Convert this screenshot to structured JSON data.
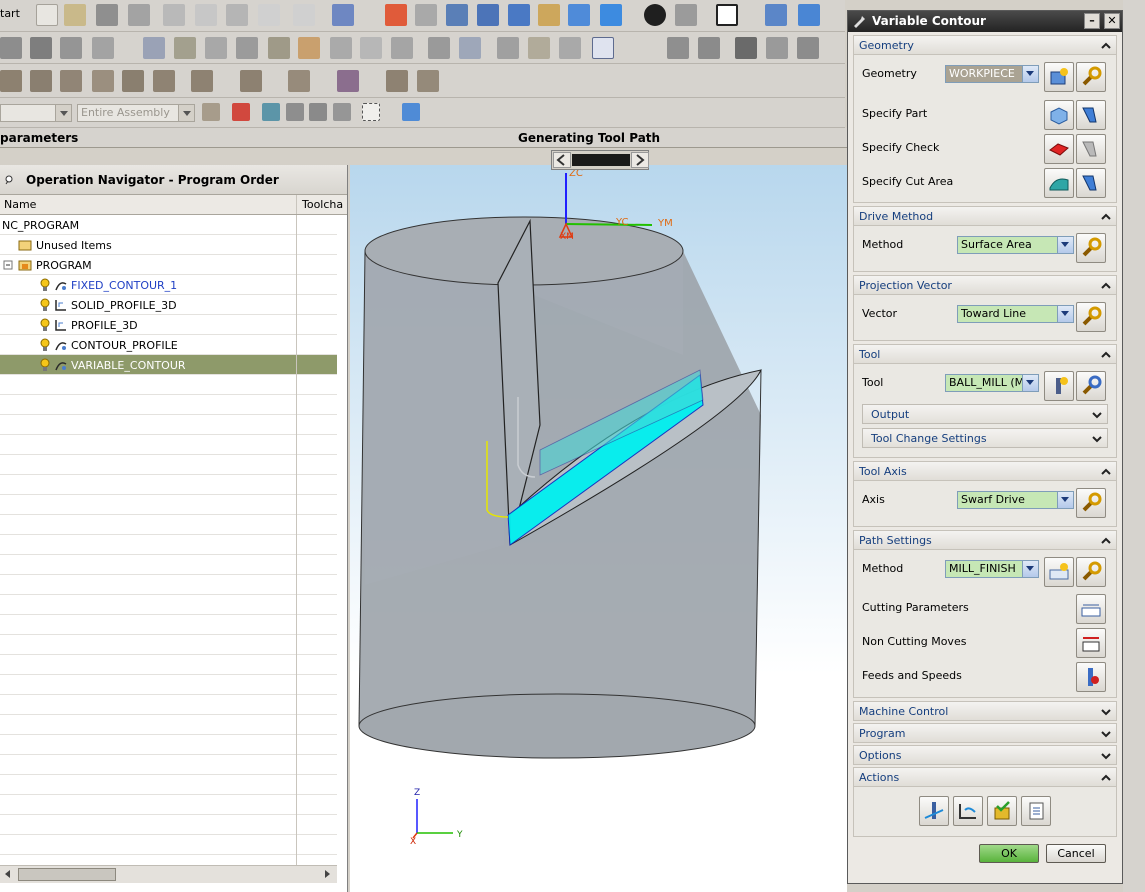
{
  "toolbar": {
    "start_label": "tart",
    "assembly_combo": "Entire Assembly"
  },
  "status": {
    "left": "parameters",
    "center": "Generating Tool Path"
  },
  "navigator": {
    "title": "Operation Navigator - Program Order",
    "columns": [
      "Name",
      "Toolcha"
    ],
    "rows": [
      {
        "label": "NC_PROGRAM",
        "indent": 0,
        "icon": "none"
      },
      {
        "label": "Unused Items",
        "indent": 1,
        "icon": "folder-icon"
      },
      {
        "label": "PROGRAM",
        "indent": 1,
        "icon": "program-folder-icon"
      },
      {
        "label": "FIXED_CONTOUR_1",
        "indent": 2,
        "icon": "contour-op-icon",
        "link": true
      },
      {
        "label": "SOLID_PROFILE_3D",
        "indent": 2,
        "icon": "profile-op-icon"
      },
      {
        "label": "PROFILE_3D",
        "indent": 2,
        "icon": "profile-op-icon"
      },
      {
        "label": "CONTOUR_PROFILE",
        "indent": 2,
        "icon": "contour-op-icon"
      },
      {
        "label": "VARIABLE_CONTOUR",
        "indent": 2,
        "icon": "contour-op-icon",
        "selected": true
      }
    ]
  },
  "viewport": {
    "wcs_labels": {
      "zc": "ZC",
      "yc": "YC",
      "ym": "YM",
      "xm": "XM"
    },
    "triad": {
      "z": "Z",
      "y": "Y",
      "x": "X"
    }
  },
  "dialog": {
    "title": "Variable Contour",
    "geometry": {
      "header": "Geometry",
      "geometry_label": "Geometry",
      "geometry_value": "WORKPIECE",
      "specify_part": "Specify Part",
      "specify_check": "Specify Check",
      "specify_cut_area": "Specify Cut Area"
    },
    "drive": {
      "header": "Drive Method",
      "label": "Method",
      "value": "Surface Area"
    },
    "projection": {
      "header": "Projection Vector",
      "label": "Vector",
      "value": "Toward Line"
    },
    "tool": {
      "header": "Tool",
      "label": "Tool",
      "value": "BALL_MILL (Mill",
      "output": "Output",
      "tool_change": "Tool Change Settings"
    },
    "tool_axis": {
      "header": "Tool Axis",
      "label": "Axis",
      "value": "Swarf Drive"
    },
    "path": {
      "header": "Path Settings",
      "label": "Method",
      "value": "MILL_FINISH",
      "cutting": "Cutting Parameters",
      "non_cutting": "Non Cutting Moves",
      "feeds": "Feeds and Speeds"
    },
    "machine_control": "Machine Control",
    "program": "Program",
    "options": "Options",
    "actions": "Actions",
    "ok": "OK",
    "cancel": "Cancel"
  },
  "colors": {
    "selection": "#8e9a6a",
    "section_text": "#153e7e",
    "combo_green": "#c6e7b5",
    "toolpath": "#00f0f0"
  }
}
